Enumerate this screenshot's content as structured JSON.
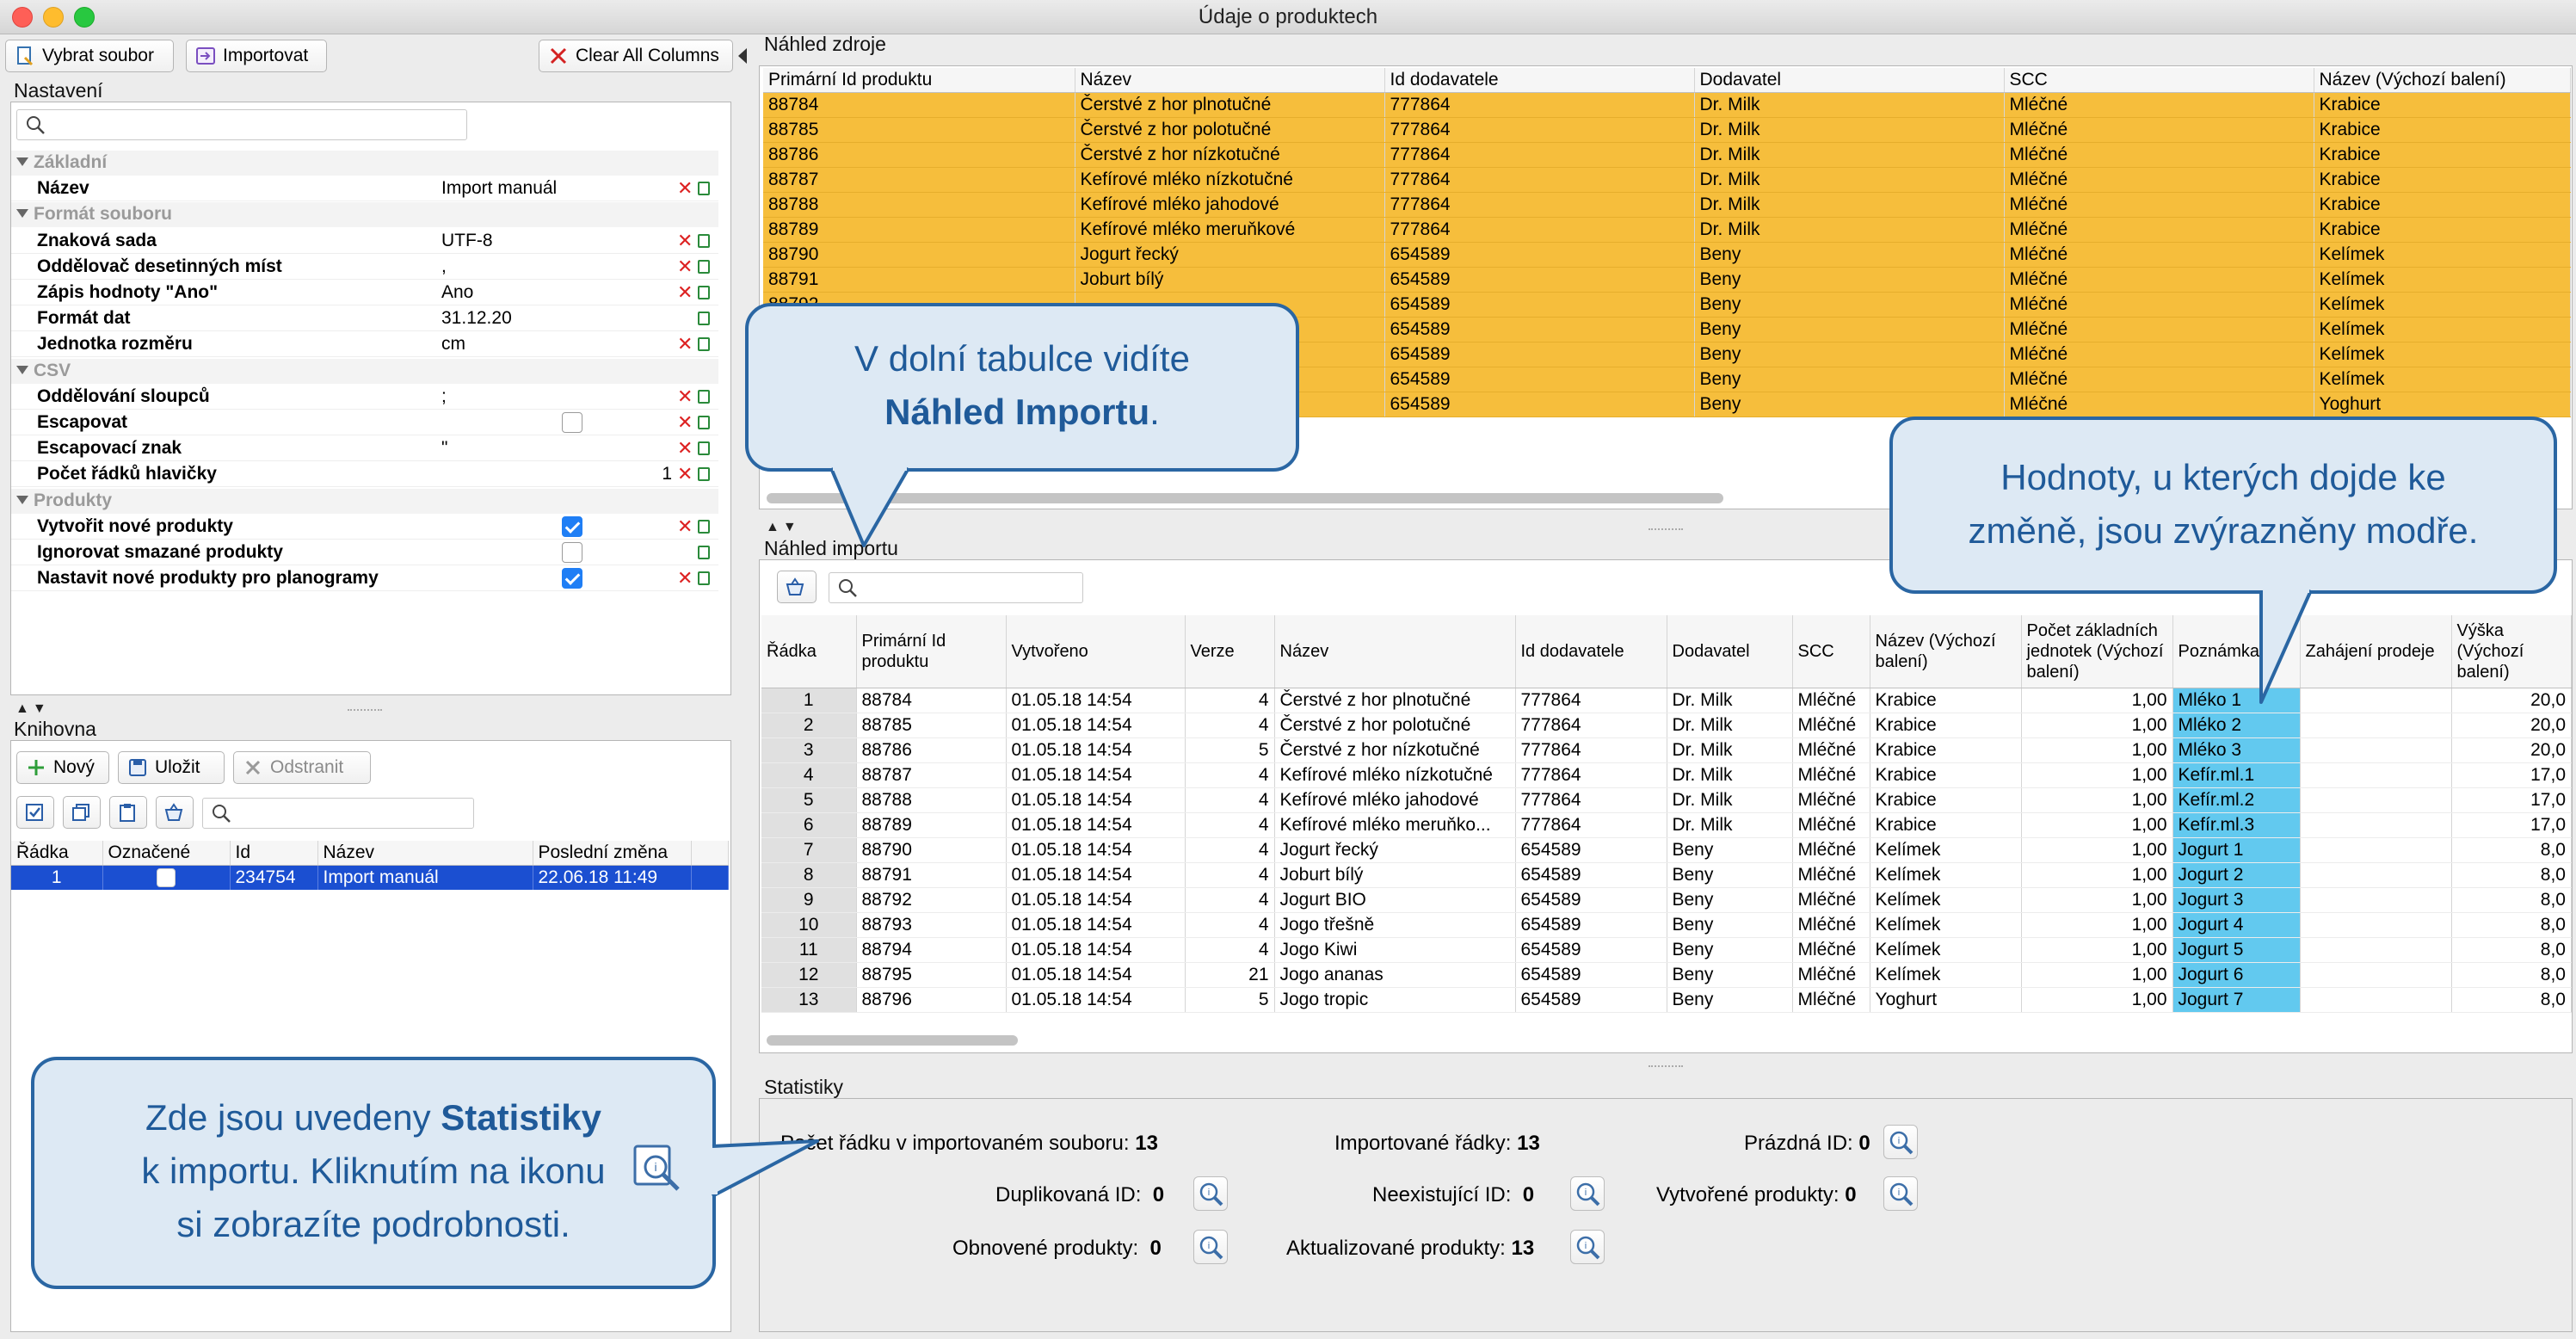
{
  "window": {
    "title": "Údaje o produktech"
  },
  "toolbar": {
    "select_file": "Vybrat soubor",
    "import": "Importovat",
    "clear_columns": "Clear All Columns"
  },
  "settings": {
    "label": "Nastavení",
    "rows": [
      {
        "type": "cat",
        "key": "Základní"
      },
      {
        "type": "prop",
        "key": "Název",
        "value": "Import manuál",
        "x": true,
        "c": true
      },
      {
        "type": "cat",
        "key": "Formát souboru"
      },
      {
        "type": "prop",
        "key": "Znaková sada",
        "value": "UTF-8",
        "x": true,
        "c": true
      },
      {
        "type": "prop",
        "key": "Oddělovač desetinných míst",
        "value": ",",
        "x": true,
        "c": true
      },
      {
        "type": "prop",
        "key": "Zápis hodnoty \"Ano\"",
        "value": "Ano",
        "x": true,
        "c": true
      },
      {
        "type": "prop",
        "key": "Formát dat",
        "value": "31.12.20",
        "x": false,
        "c": true
      },
      {
        "type": "prop",
        "key": "Jednotka rozměru",
        "value": "cm",
        "x": true,
        "c": true
      },
      {
        "type": "cat",
        "key": "CSV"
      },
      {
        "type": "prop",
        "key": "Oddělování sloupců",
        "value": ";",
        "x": true,
        "c": true
      },
      {
        "type": "prop",
        "key": "Escapovat",
        "checkbox": false,
        "x": true,
        "c": true
      },
      {
        "type": "prop",
        "key": "Escapovací znak",
        "value": "\"",
        "x": true,
        "c": true
      },
      {
        "type": "prop",
        "key": "Počet řádků hlavičky",
        "value": "1",
        "right": true,
        "x": true,
        "c": true
      },
      {
        "type": "cat",
        "key": "Produkty"
      },
      {
        "type": "prop",
        "key": "Vytvořit nové produkty",
        "checkbox": true,
        "x": true,
        "c": true
      },
      {
        "type": "prop",
        "key": "Ignorovat smazané produkty",
        "checkbox": false,
        "x": false,
        "c": true
      },
      {
        "type": "prop",
        "key": "Nastavit nové produkty pro planogramy",
        "checkbox": true,
        "x": true,
        "c": true
      }
    ]
  },
  "library": {
    "label": "Knihovna",
    "new": "Nový",
    "save": "Uložit",
    "remove": "Odstranit",
    "columns": [
      "Řádka",
      "Označené",
      "Id",
      "Název",
      "Poslední změna"
    ],
    "rows": [
      [
        "1",
        "",
        "234754",
        "Import manuál",
        "22.06.18 11:49"
      ]
    ]
  },
  "source": {
    "label": "Náhled zdroje",
    "columns": [
      "Primární Id produktu",
      "Název",
      "Id dodavatele",
      "Dodavatel",
      "SCC",
      "Název (Výchozí balení)"
    ],
    "rows": [
      [
        "88784",
        "Čerstvé z hor plnotučné",
        "777864",
        "Dr. Milk",
        "Mléčné",
        "Krabice"
      ],
      [
        "88785",
        "Čerstvé z hor polotučné",
        "777864",
        "Dr. Milk",
        "Mléčné",
        "Krabice"
      ],
      [
        "88786",
        "Čerstvé z hor nízkotučné",
        "777864",
        "Dr. Milk",
        "Mléčné",
        "Krabice"
      ],
      [
        "88787",
        "Kefírové mléko nízkotučné",
        "777864",
        "Dr. Milk",
        "Mléčné",
        "Krabice"
      ],
      [
        "88788",
        "Kefírové mléko jahodové",
        "777864",
        "Dr. Milk",
        "Mléčné",
        "Krabice"
      ],
      [
        "88789",
        "Kefírové mléko meruňkové",
        "777864",
        "Dr. Milk",
        "Mléčné",
        "Krabice"
      ],
      [
        "88790",
        "Jogurt řecký",
        "654589",
        "Beny",
        "Mléčné",
        "Kelímek"
      ],
      [
        "88791",
        "Joburt bílý",
        "654589",
        "Beny",
        "Mléčné",
        "Kelímek"
      ],
      [
        "88792",
        "",
        "654589",
        "Beny",
        "Mléčné",
        "Kelímek"
      ],
      [
        "",
        "",
        "654589",
        "Beny",
        "Mléčné",
        "Kelímek"
      ],
      [
        "",
        "",
        "654589",
        "Beny",
        "Mléčné",
        "Kelímek"
      ],
      [
        "",
        "",
        "654589",
        "Beny",
        "Mléčné",
        "Kelímek"
      ],
      [
        "",
        "",
        "654589",
        "Beny",
        "Mléčné",
        "Yoghurt"
      ]
    ]
  },
  "import_preview": {
    "label": "Náhled importu",
    "columns": [
      "Řádka",
      "Primární Id produktu",
      "Vytvořeno",
      "Verze",
      "Název",
      "Id dodavatele",
      "Dodavatel",
      "SCC",
      "Název (Výchozí balení)",
      "Počet základních jednotek (Výchozí balení)",
      "Poznámka",
      "Zahájení prodeje",
      "Výška (Výchozí balení)"
    ],
    "rows": [
      [
        "1",
        "88784",
        "01.05.18 14:54",
        "4",
        "Čerstvé z hor plnotučné",
        "777864",
        "Dr. Milk",
        "Mléčné",
        "Krabice",
        "1,00",
        "Mléko 1",
        "",
        "20,0"
      ],
      [
        "2",
        "88785",
        "01.05.18 14:54",
        "4",
        "Čerstvé z hor polotučné",
        "777864",
        "Dr. Milk",
        "Mléčné",
        "Krabice",
        "1,00",
        "Mléko 2",
        "",
        "20,0"
      ],
      [
        "3",
        "88786",
        "01.05.18 14:54",
        "5",
        "Čerstvé z hor nízkotučné",
        "777864",
        "Dr. Milk",
        "Mléčné",
        "Krabice",
        "1,00",
        "Mléko 3",
        "",
        "20,0"
      ],
      [
        "4",
        "88787",
        "01.05.18 14:54",
        "4",
        "Kefírové mléko nízkotučné",
        "777864",
        "Dr. Milk",
        "Mléčné",
        "Krabice",
        "1,00",
        "Kefír.ml.1",
        "",
        "17,0"
      ],
      [
        "5",
        "88788",
        "01.05.18 14:54",
        "4",
        "Kefírové mléko jahodové",
        "777864",
        "Dr. Milk",
        "Mléčné",
        "Krabice",
        "1,00",
        "Kefír.ml.2",
        "",
        "17,0"
      ],
      [
        "6",
        "88789",
        "01.05.18 14:54",
        "4",
        "Kefírové mléko meruňko...",
        "777864",
        "Dr. Milk",
        "Mléčné",
        "Krabice",
        "1,00",
        "Kefír.ml.3",
        "",
        "17,0"
      ],
      [
        "7",
        "88790",
        "01.05.18 14:54",
        "4",
        "Jogurt řecký",
        "654589",
        "Beny",
        "Mléčné",
        "Kelímek",
        "1,00",
        "Jogurt 1",
        "",
        "8,0"
      ],
      [
        "8",
        "88791",
        "01.05.18 14:54",
        "4",
        "Joburt bílý",
        "654589",
        "Beny",
        "Mléčné",
        "Kelímek",
        "1,00",
        "Jogurt 2",
        "",
        "8,0"
      ],
      [
        "9",
        "88792",
        "01.05.18 14:54",
        "4",
        "Jogurt BIO",
        "654589",
        "Beny",
        "Mléčné",
        "Kelímek",
        "1,00",
        "Jogurt 3",
        "",
        "8,0"
      ],
      [
        "10",
        "88793",
        "01.05.18 14:54",
        "4",
        "Jogo třešně",
        "654589",
        "Beny",
        "Mléčné",
        "Kelímek",
        "1,00",
        "Jogurt 4",
        "",
        "8,0"
      ],
      [
        "11",
        "88794",
        "01.05.18 14:54",
        "4",
        "Jogo Kiwi",
        "654589",
        "Beny",
        "Mléčné",
        "Kelímek",
        "1,00",
        "Jogurt 5",
        "",
        "8,0"
      ],
      [
        "12",
        "88795",
        "01.05.18 14:54",
        "21",
        "Jogo ananas",
        "654589",
        "Beny",
        "Mléčné",
        "Kelímek",
        "1,00",
        "Jogurt 6",
        "",
        "8,0"
      ],
      [
        "13",
        "88796",
        "01.05.18 14:54",
        "5",
        "Jogo tropic",
        "654589",
        "Beny",
        "Mléčné",
        "Yoghurt",
        "1,00",
        "Jogurt 7",
        "",
        "8,0"
      ]
    ]
  },
  "statistics": {
    "label": "Statistiky",
    "rows_in_file_label": "Počet řádku v importovaném souboru:",
    "rows_in_file": "13",
    "imported_rows_label": "Importované řádky:",
    "imported_rows": "13",
    "empty_id_label": "Prázdná ID:",
    "empty_id": "0",
    "duplicate_id_label": "Duplikovaná ID:",
    "duplicate_id": "0",
    "nonexistent_id_label": "Neexistující ID:",
    "nonexistent_id": "0",
    "created_label": "Vytvořené produkty:",
    "created": "0",
    "restored_label": "Obnovené produkty:",
    "restored": "0",
    "updated_label": "Aktualizované produkty:",
    "updated": "13"
  },
  "callouts": {
    "preview_line1": "V dolní tabulce vidíte",
    "preview_bold": "Náhled Importu",
    "preview_end": ".",
    "highlight_line1": "Hodnoty, u kterých dojde ke",
    "highlight_line2": "změně, jsou zvýrazněny modře.",
    "stats_pre": "Zde jsou uvedeny ",
    "stats_bold": "Statistiky",
    "stats_line2": "k importu. Kliknutím na ikonu",
    "stats_line3": "si zobrazíte podrobnosti."
  },
  "colors": {
    "source_row": "#f6be3c",
    "changed_cell": "#62c9ef",
    "selected_row": "#1b4fd1",
    "callout_border": "#2a66a3"
  }
}
